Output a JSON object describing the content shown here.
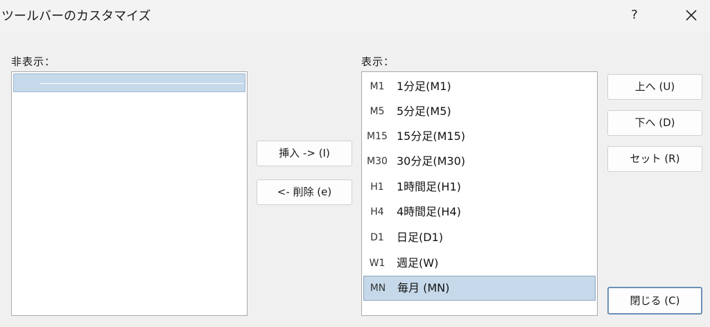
{
  "window": {
    "title": "ツールバーのカスタマイズ",
    "help_label": "?"
  },
  "hidden_panel": {
    "label": "非表示：",
    "items": [
      ""
    ]
  },
  "shown_panel": {
    "label": "表示：",
    "items": [
      {
        "icon": "M1",
        "label": "1分足(M1)"
      },
      {
        "icon": "M5",
        "label": "5分足(M5)"
      },
      {
        "icon": "M15",
        "label": "15分足(M15)"
      },
      {
        "icon": "M30",
        "label": "30分足(M30)"
      },
      {
        "icon": "H1",
        "label": "1時間足(H1)"
      },
      {
        "icon": "H4",
        "label": "4時間足(H4)"
      },
      {
        "icon": "D1",
        "label": "日足(D1)"
      },
      {
        "icon": "W1",
        "label": "週足(W)"
      },
      {
        "icon": "MN",
        "label": "毎月 (MN)"
      }
    ],
    "selected_index": 8
  },
  "buttons": {
    "insert": "挿入 -> (I)",
    "remove": "<- 削除 (e)",
    "up": "上へ (U)",
    "down": "下へ (D)",
    "reset": "セット (R)",
    "close": "閉じる (C)"
  },
  "colors": {
    "selection": "#c6d9ea",
    "default_button_border": "#6b8fb5"
  }
}
